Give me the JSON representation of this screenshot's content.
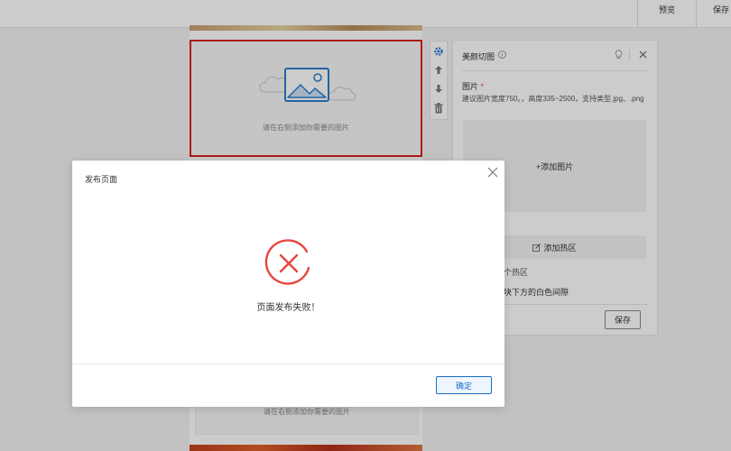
{
  "topbar": {
    "preview_label": "预览",
    "save_label": "保存"
  },
  "canvas": {
    "placeholder_text": "请在右侧添加你需要的图片",
    "placeholder_text_bottom": "请在右侧添加你需要的图片"
  },
  "panel": {
    "title": "美颜切图",
    "field_label": "图片",
    "required_mark": "*",
    "hint": "建议图片宽度750。，高度335~2500，支持类型.jpg、.png",
    "upload_label": "+添加图片",
    "hotspot_label": "添加热区",
    "hotspot_count_text": "个热区",
    "gap_text": "块下方的白色间隙",
    "save_label": "保存"
  },
  "modal": {
    "title": "发布页面",
    "message": "页面发布失败！",
    "confirm_label": "确定"
  },
  "colors": {
    "error_red": "#e8453c",
    "selection_red": "#d9221f",
    "primary_blue": "#1a70c8"
  },
  "icons": {
    "modal_close": "close-icon",
    "error": "error-x-icon",
    "panel_info": "info-icon",
    "panel_tip": "lightbulb-icon",
    "panel_close": "close-icon",
    "settings": "gear-icon",
    "move_up": "arrow-up-icon",
    "move_down": "arrow-down-icon",
    "delete": "trash-icon",
    "placeholder": "image-icon",
    "edit": "edit-icon"
  }
}
